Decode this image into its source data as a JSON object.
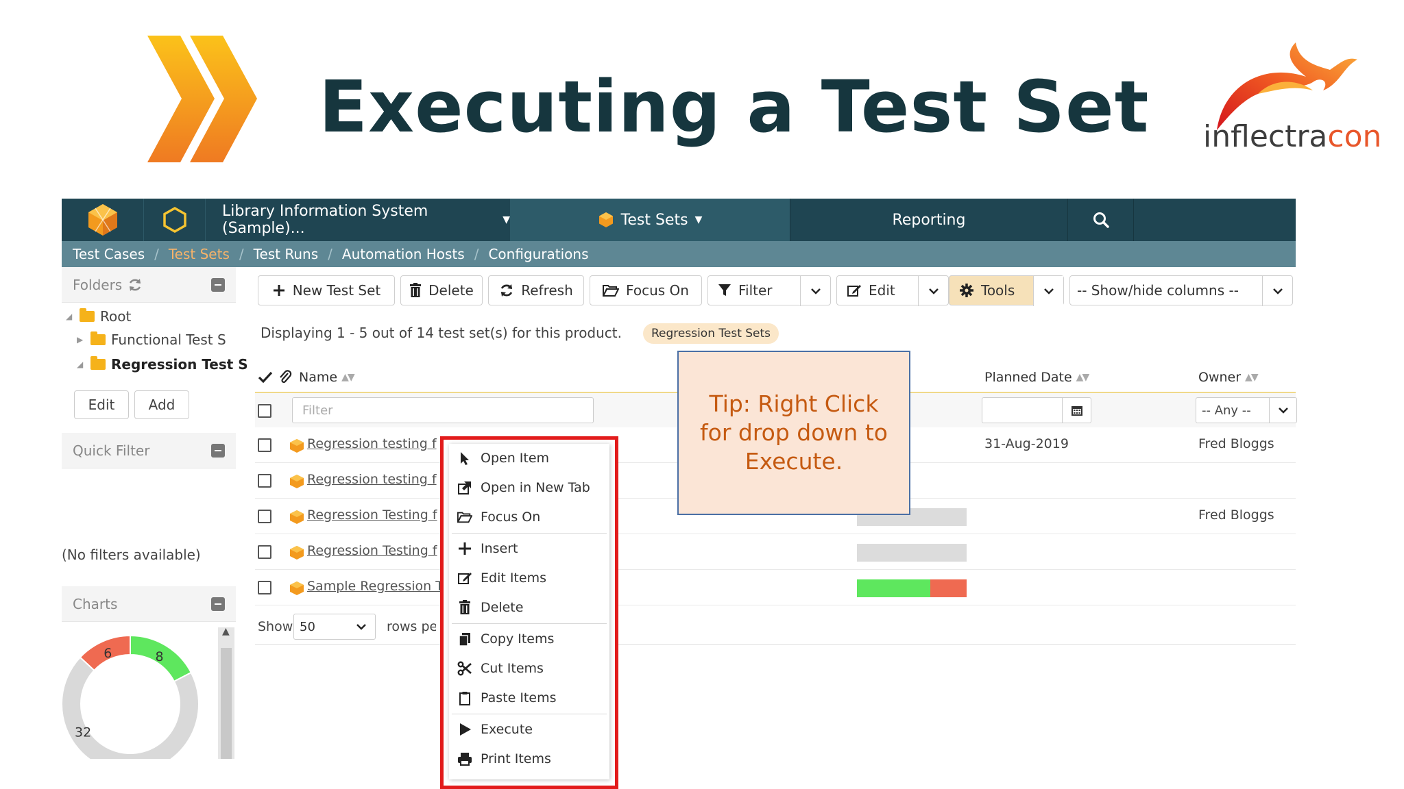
{
  "slide": {
    "title": "Executing a Test Set",
    "brand_part1": "inflectra",
    "brand_part2": "con"
  },
  "colors": {
    "title": "#16363e",
    "nav_bg": "#1f4552",
    "subnav_bg": "#5e8794",
    "highlight_red": "#e21b1b",
    "tip_bg": "#fbe5d6",
    "tip_text": "#c55a11"
  },
  "topnav": {
    "project": "Library Information System (Sample)...",
    "testsets": "Test Sets",
    "reporting": "Reporting"
  },
  "subnav": {
    "items": [
      "Test Cases",
      "Test Sets",
      "Test Runs",
      "Automation Hosts",
      "Configurations"
    ],
    "active_index": 1
  },
  "left": {
    "folders_label": "Folders",
    "tree": [
      "Root",
      "Functional Test S",
      "Regression Test S"
    ],
    "edit": "Edit",
    "add": "Add",
    "quick_filter": "Quick Filter",
    "no_filters": "(No filters available)",
    "charts": "Charts",
    "donut": {
      "values": [
        6,
        8,
        32
      ],
      "labels": [
        "6",
        "8",
        "32"
      ],
      "colors": [
        "#ef6a51",
        "#5ee75e",
        "#d9d9d9"
      ]
    }
  },
  "toolbar": {
    "new_test_set": "New Test Set",
    "delete": "Delete",
    "refresh": "Refresh",
    "focus_on": "Focus On",
    "filter": "Filter",
    "edit": "Edit",
    "tools": "Tools",
    "show_hide": "-- Show/hide columns --"
  },
  "grid": {
    "displaying": "Displaying 1 - 5 out of 14 test set(s) for this product.",
    "badge": "Regression Test Sets",
    "col_name": "Name",
    "col_planned": "Planned Date",
    "col_owner": "Owner",
    "filter_placeholder": "Filter",
    "owner_any": "-- Any --",
    "rows": [
      {
        "name": "Regression testing f",
        "date": "31-Aug-2019",
        "owner": "Fred Bloggs",
        "progress": null
      },
      {
        "name": "Regression testing f",
        "date": "",
        "owner": "",
        "progress": null
      },
      {
        "name": "Regression Testing f",
        "date": "",
        "owner": "Fred Bloggs",
        "progress": {
          "pass": 0,
          "fail": 0
        }
      },
      {
        "name": "Regression Testing f",
        "date": "",
        "owner": "",
        "progress": {
          "pass": 0,
          "fail": 0
        }
      },
      {
        "name": "Sample Regression T",
        "date": "",
        "owner": "",
        "progress": {
          "pass": 0.67,
          "fail": 0.33
        }
      }
    ],
    "show": "Show",
    "rows_value": "50",
    "rows_per": "rows per page"
  },
  "context_menu": {
    "items": [
      "Open Item",
      "Open in New Tab",
      "Focus On",
      "Insert",
      "Edit Items",
      "Delete",
      "Copy Items",
      "Cut Items",
      "Paste Items",
      "Execute",
      "Print Items"
    ]
  },
  "tip": {
    "text": "Tip:  Right Click for drop down to Execute."
  }
}
